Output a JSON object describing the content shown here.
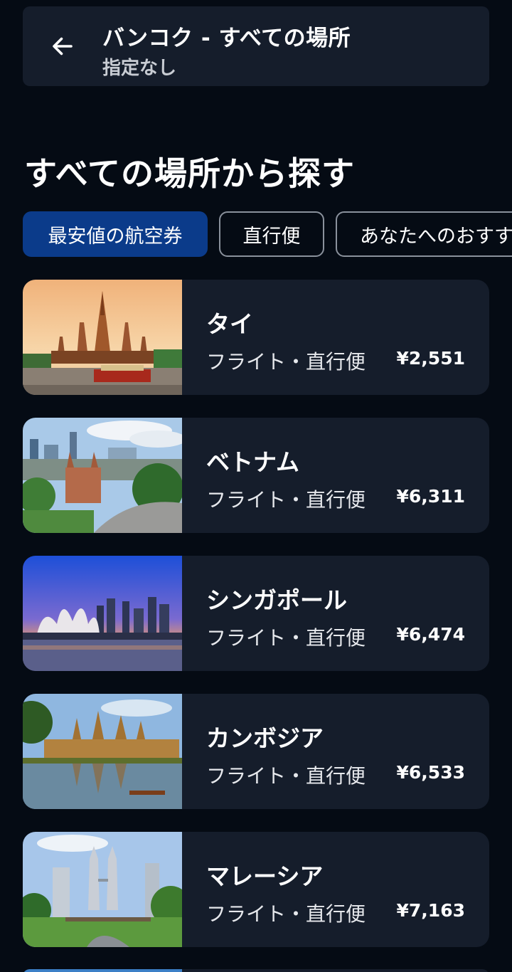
{
  "header": {
    "title": "バンコク - すべての場所",
    "subtitle": "指定なし"
  },
  "section_title": "すべての場所から探す",
  "chips": [
    {
      "label": "最安値の航空券",
      "active": true
    },
    {
      "label": "直行便",
      "active": false
    },
    {
      "label": "あなたへのおすすめ",
      "active": false
    }
  ],
  "destinations": [
    {
      "name": "タイ",
      "meta": "フライト・直行便",
      "price": "¥2,551",
      "image": "wat-arun-temple"
    },
    {
      "name": "ベトナム",
      "meta": "フライト・直行便",
      "price": "¥6,311",
      "image": "ho-chi-minh-cathedral"
    },
    {
      "name": "シンガポール",
      "meta": "フライト・直行便",
      "price": "¥6,474",
      "image": "marina-bay-skyline"
    },
    {
      "name": "カンボジア",
      "meta": "フライト・直行便",
      "price": "¥6,533",
      "image": "angkor-wat"
    },
    {
      "name": "マレーシア",
      "meta": "フライト・直行便",
      "price": "¥7,163",
      "image": "petronas-towers"
    }
  ],
  "icons": {
    "back": "arrow-left-icon"
  }
}
